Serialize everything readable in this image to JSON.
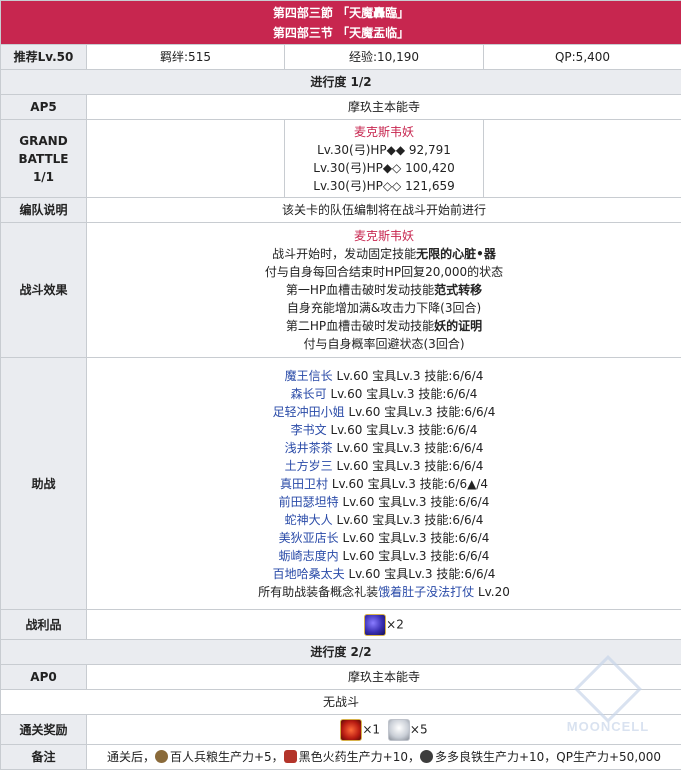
{
  "header": {
    "title_jp": "第四部三節 「天魔轟臨」",
    "title_cn": "第四部三节 「天魔盂临」"
  },
  "info": {
    "level_label": "推荐Lv.50",
    "bond": "羁绊:515",
    "exp": "经验:10,190",
    "qp": "QP:5,400"
  },
  "progress1": {
    "label": "进行度 1/2"
  },
  "ap1": {
    "label": "AP5",
    "location": "摩玖主本能寺"
  },
  "battle": {
    "label_line1": "GRAND",
    "label_line2": "BATTLE",
    "label_line3": "1/1",
    "enemy_name": "麦克斯韦妖",
    "hp_lines": [
      "Lv.30(弓)HP◆◆ 92,791",
      "Lv.30(弓)HP◆◇ 100,420",
      "Lv.30(弓)HP◇◇ 121,659"
    ]
  },
  "party_note": {
    "label": "编队说明",
    "text": "该关卡的队伍编制将在战斗开始前进行"
  },
  "effects": {
    "label": "战斗效果",
    "enemy_name": "麦克斯韦妖",
    "line1_prefix": "战斗开始时，发动固定技能",
    "line1_bold": "无限的心脏•器",
    "line2": "付与自身每回合结束时HP回复20,000的状态",
    "line3_prefix": "第一HP血槽击破时发动技能",
    "line3_bold": "范式转移",
    "line4": "自身充能增加满&攻击力下降(3回合)",
    "line5_prefix": "第二HP血槽击破时发动技能",
    "line5_bold": "妖的证明",
    "line6": "付与自身概率回避状态(3回合)"
  },
  "support": {
    "label": "助战",
    "items": [
      {
        "name": "魔王信长",
        "stats": " Lv.60 宝具Lv.3 技能:6/6/4"
      },
      {
        "name": "森长可",
        "stats": " Lv.60 宝具Lv.3 技能:6/6/4"
      },
      {
        "name": "足轻冲田小姐",
        "stats": " Lv.60 宝具Lv.3 技能:6/6/4"
      },
      {
        "name": "李书文",
        "stats": " Lv.60 宝具Lv.3 技能:6/6/4"
      },
      {
        "name": "浅井茶茶",
        "stats": " Lv.60 宝具Lv.3 技能:6/6/4"
      },
      {
        "name": "土方岁三",
        "stats": " Lv.60 宝具Lv.3 技能:6/6/4"
      },
      {
        "name": "真田卫村",
        "stats": " Lv.60 宝具Lv.3 技能:6/6▲/4"
      },
      {
        "name": "前田瑟坦特",
        "stats": " Lv.60 宝具Lv.3 技能:6/6/4"
      },
      {
        "name": "蛇神大人",
        "stats": " Lv.60 宝具Lv.3 技能:6/6/4"
      },
      {
        "name": "美狄亚店长",
        "stats": " Lv.60 宝具Lv.3 技能:6/6/4"
      },
      {
        "name": "蛎崎志度内",
        "stats": " Lv.60 宝具Lv.3 技能:6/6/4"
      },
      {
        "name": "百地哈桑太夫",
        "stats": " Lv.60 宝具Lv.3 技能:6/6/4"
      }
    ],
    "ce_prefix": "所有助战装备概念礼装",
    "ce_name": "饿着肚子没法打仗",
    "ce_level": " Lv.20"
  },
  "drops": {
    "label": "战利品",
    "icon": "purple-gem-icon",
    "count": "×2"
  },
  "progress2": {
    "label": "进行度 2/2"
  },
  "ap2": {
    "label": "AP0",
    "location": "摩玖主本能寺",
    "battle_text": "无战斗"
  },
  "rewards": {
    "label": "通关奖励",
    "item1_icon": "red-flame-icon",
    "item1_count": "×1",
    "item2_icon": "white-bottle-icon",
    "item2_count": "×5"
  },
  "notes": {
    "label": "备注",
    "prefix": "通关后，",
    "item1": "百人兵粮生产力+5，",
    "item2": "黑色火药生产力+10，",
    "item3": "多多良铁生产力+10，QP生产力+50,000"
  },
  "watermark": {
    "text": "MOONCELL"
  }
}
